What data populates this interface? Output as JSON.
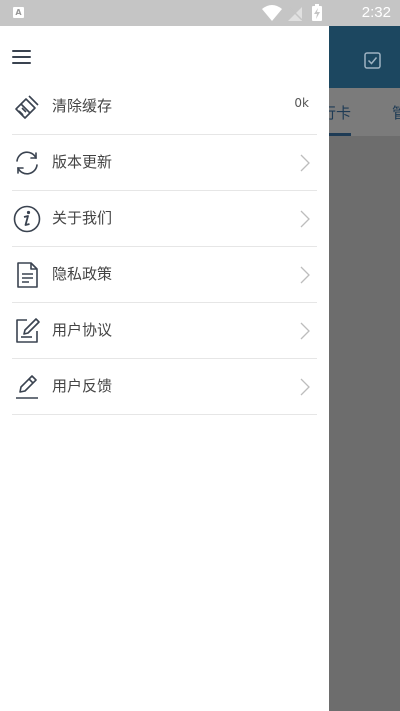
{
  "status_bar": {
    "notification_icon": "A",
    "time": "2:32",
    "icons": [
      "wifi-icon",
      "no-signal-icon",
      "battery-charging-icon"
    ]
  },
  "background": {
    "tab_active": "行卡",
    "tab_next": "管"
  },
  "drawer": {
    "items": [
      {
        "label": "清除缓存",
        "value": "0k",
        "icon": "broom-icon"
      },
      {
        "label": "版本更新",
        "icon": "refresh-icon"
      },
      {
        "label": "关于我们",
        "icon": "info-icon"
      },
      {
        "label": "隐私政策",
        "icon": "document-icon"
      },
      {
        "label": "用户协议",
        "icon": "edit-document-icon"
      },
      {
        "label": "用户反馈",
        "icon": "pen-icon"
      }
    ]
  },
  "colors": {
    "toolbar": "#1c4760",
    "icon": "#3a4350",
    "chevron": "#bdbdbd",
    "divider": "#e6e6e6"
  }
}
